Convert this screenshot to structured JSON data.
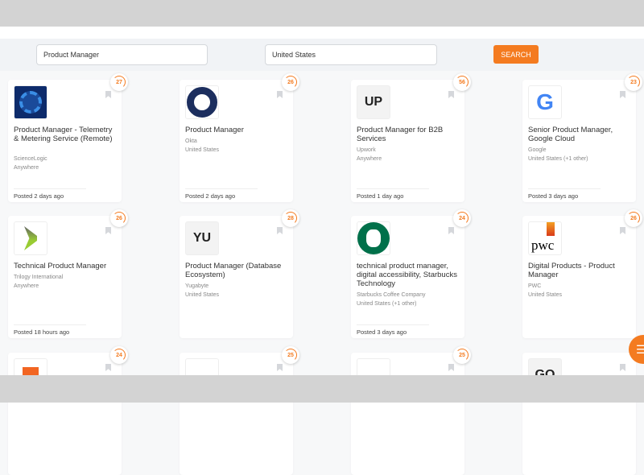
{
  "search": {
    "keyword": "Product Manager",
    "location": "United States",
    "button": "SEARCH"
  },
  "colors": {
    "accent": "#f47b20"
  },
  "jobs": [
    {
      "score": "27",
      "title": "Product Manager - Telemetry & Metering Service (Remote)",
      "company": "ScienceLogic",
      "location": "Anywhere",
      "posted": "Posted 2 days ago",
      "logo": "brain-gear"
    },
    {
      "score": "26",
      "title": "Product Manager",
      "company": "Okta",
      "location": "United States",
      "posted": "Posted 2 days ago",
      "logo": "okta-ring"
    },
    {
      "score": "56",
      "title": "Product Manager for B2B Services",
      "company": "Upwork",
      "location": "Anywhere",
      "posted": "Posted 1 day ago",
      "logo_text": "UP"
    },
    {
      "score": "23",
      "title": "Senior Product Manager, Google Cloud",
      "company": "Google",
      "location": "United States (+1 other)",
      "posted": "Posted 3 days ago",
      "logo": "google-g"
    },
    {
      "score": "26",
      "title": "Technical Product Manager",
      "company": "Trilogy International",
      "location": "Anywhere",
      "posted": "Posted 18 hours ago",
      "logo": "trilogy"
    },
    {
      "score": "28",
      "title": "Product Manager (Database Ecosystem)",
      "company": "Yugabyte",
      "location": "United States",
      "posted": "",
      "logo_text": "YU"
    },
    {
      "score": "24",
      "title": "technical product manager, digital accessibility, Starbucks Technology",
      "company": "Starbucks Coffee Company",
      "location": "United States (+1 other)",
      "posted": "Posted 3 days ago",
      "logo": "starbucks"
    },
    {
      "score": "26",
      "title": "Digital Products - Product Manager",
      "company": "PWC",
      "location": "United States",
      "posted": "",
      "logo": "pwc",
      "logo_text": "pwc"
    },
    {
      "score": "24",
      "logo": "orange-shield"
    },
    {
      "score": "25",
      "logo": "city-skyline"
    },
    {
      "score": "25",
      "logo": "microsoft"
    },
    {
      "score": "",
      "logo_text": "GO"
    }
  ]
}
